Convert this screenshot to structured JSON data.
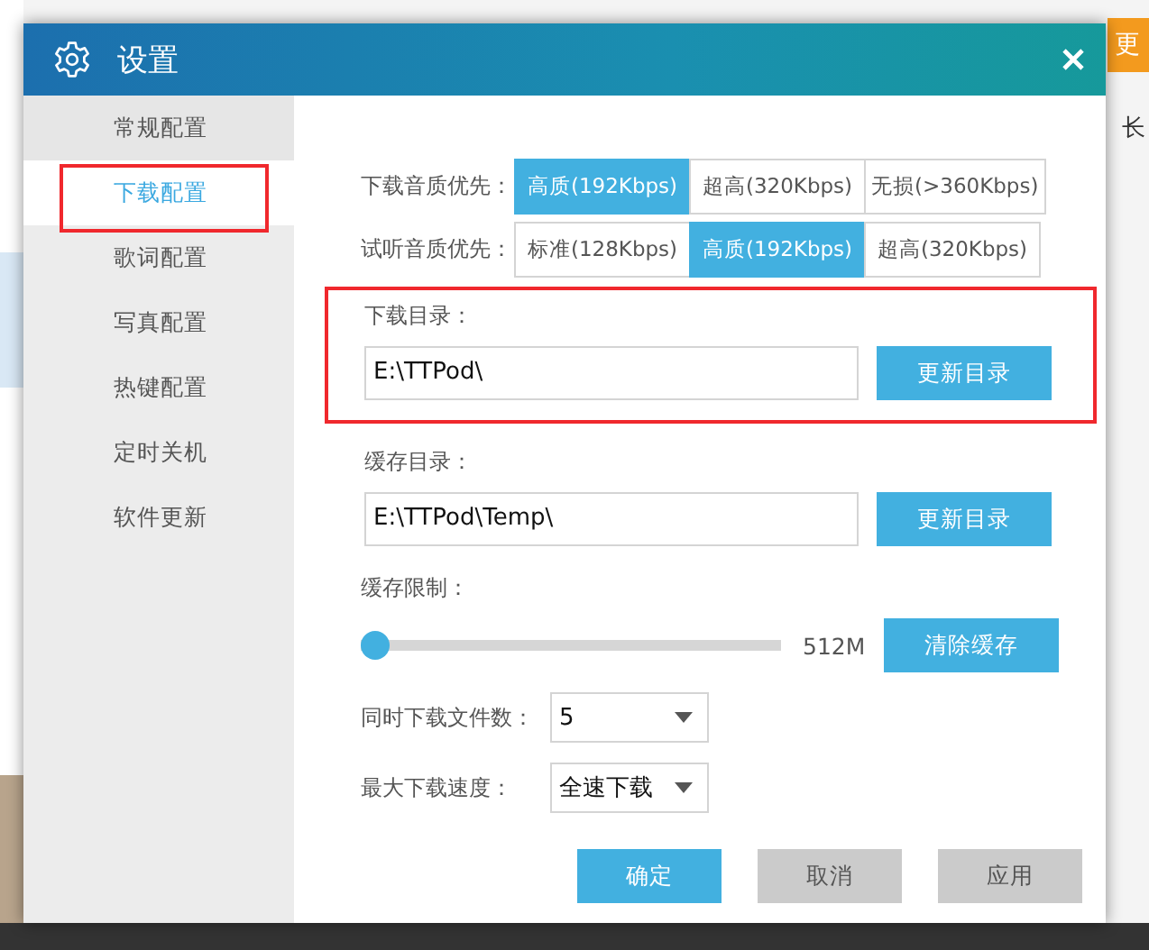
{
  "background": {
    "button": "更",
    "text": "长"
  },
  "window": {
    "title": "设置"
  },
  "sidebar": {
    "items": [
      {
        "label": "常规配置",
        "selected": false
      },
      {
        "label": "下载配置",
        "selected": true
      },
      {
        "label": "歌词配置",
        "selected": false
      },
      {
        "label": "写真配置",
        "selected": false
      },
      {
        "label": "热键配置",
        "selected": false
      },
      {
        "label": "定时关机",
        "selected": false
      },
      {
        "label": "软件更新",
        "selected": false
      }
    ]
  },
  "quality": [
    {
      "label": "下载音质优先：",
      "options": [
        {
          "label": "高质(192Kbps)",
          "selected": true
        },
        {
          "label": "超高(320Kbps)",
          "selected": false
        },
        {
          "label": "无损(>360Kbps)",
          "selected": false
        }
      ]
    },
    {
      "label": "试听音质优先：",
      "options": [
        {
          "label": "标准(128Kbps)",
          "selected": false
        },
        {
          "label": "高质(192Kbps)",
          "selected": true
        },
        {
          "label": "超高(320Kbps)",
          "selected": false
        }
      ]
    }
  ],
  "folders": [
    {
      "label": "下载目录：",
      "value": "E:\\TTPod\\",
      "button": "更新目录",
      "highlighted": true
    },
    {
      "label": "缓存目录：",
      "value": "E:\\TTPod\\Temp\\",
      "button": "更新目录",
      "highlighted": false
    }
  ],
  "cache_limit": {
    "label": "缓存限制：",
    "level": 0,
    "reading": "512M",
    "button": "清除缓存"
  },
  "selects": [
    {
      "label": "同时下载文件数：",
      "value": "5"
    },
    {
      "label": "最大下载速度：",
      "value": "全速下载"
    }
  ],
  "buttons": [
    {
      "label": "确定",
      "kind": "primary"
    },
    {
      "label": "取消",
      "kind": "secondary"
    },
    {
      "label": "应用",
      "kind": "secondary"
    }
  ]
}
